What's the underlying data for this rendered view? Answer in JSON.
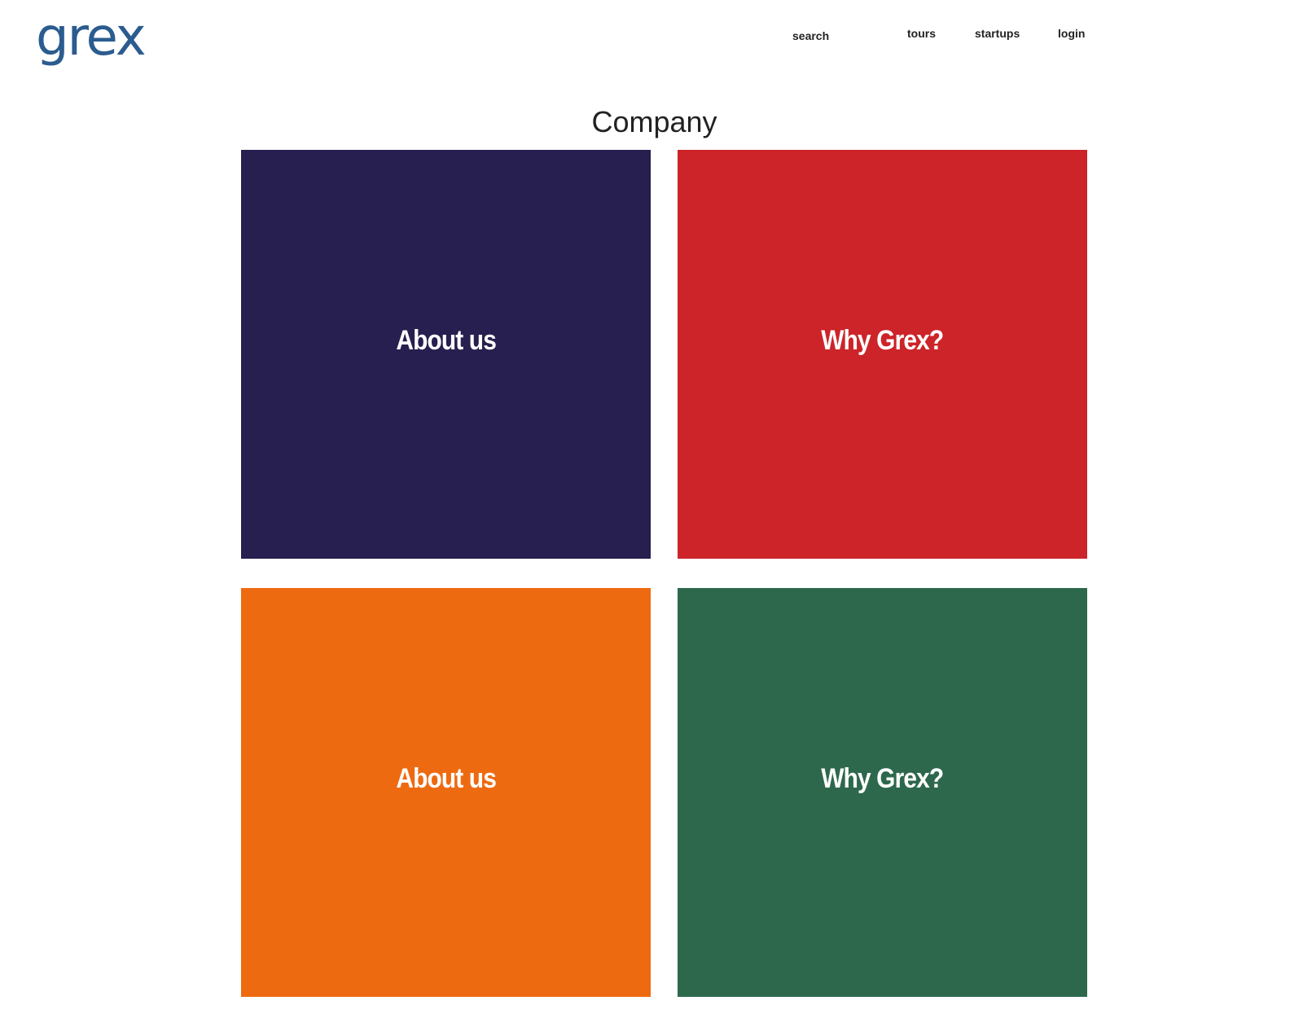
{
  "header": {
    "logo_text": "grex",
    "nav": {
      "search": "search",
      "tours": "tours",
      "startups": "startups",
      "login": "login"
    }
  },
  "main": {
    "title": "Company",
    "tiles": [
      {
        "label": "About us",
        "color": "#261f4f"
      },
      {
        "label": "Why Grex?",
        "color": "#cc2429"
      },
      {
        "label": "About us",
        "color": "#ee6a10"
      },
      {
        "label": "Why Grex?",
        "color": "#2d684c"
      }
    ]
  },
  "colors": {
    "brand": "#2b5c8f",
    "background": "#ffffff",
    "text": "#222222"
  }
}
